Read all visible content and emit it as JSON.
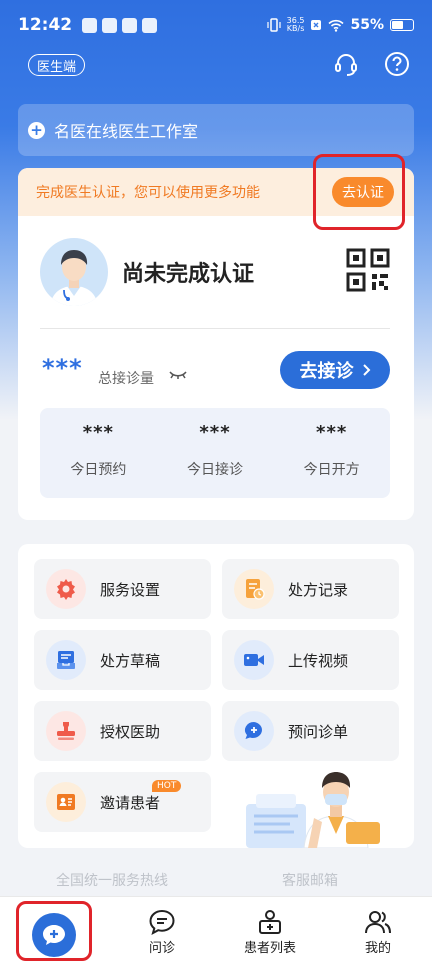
{
  "status_bar": {
    "time": "12:42",
    "net_speed_value": "36.5",
    "net_speed_unit": "KB/s",
    "battery": "55%",
    "battery_level": 0.55
  },
  "header": {
    "role_label": "医生端",
    "support_icon": "headset-icon",
    "help_icon": "question-icon"
  },
  "studio": {
    "label": "名医在线医生工作室"
  },
  "notice": {
    "text": "完成医生认证，您可以使用更多功能",
    "action": "去认证"
  },
  "profile": {
    "title": "尚未完成认证"
  },
  "totals": {
    "value": "***",
    "label": "总接诊量",
    "consult_button": "去接诊"
  },
  "stats": [
    {
      "value": "***",
      "label": "今日预约"
    },
    {
      "value": "***",
      "label": "今日接诊"
    },
    {
      "value": "***",
      "label": "今日开方"
    }
  ],
  "services": [
    {
      "label": "服务设置",
      "icon": "gear-icon",
      "color": "#ef5b4a",
      "bg": "#fde7e4"
    },
    {
      "label": "处方记录",
      "icon": "prescription-record-icon",
      "color": "#f6a23b",
      "bg": "#fdeedb"
    },
    {
      "label": "处方草稿",
      "icon": "draft-icon",
      "color": "#2f6fe0",
      "bg": "#e1ebfb"
    },
    {
      "label": "上传视频",
      "icon": "video-icon",
      "color": "#2f6fe0",
      "bg": "#e1ebfb"
    },
    {
      "label": "授权医助",
      "icon": "stamp-icon",
      "color": "#ef5b4a",
      "bg": "#fde7e4"
    },
    {
      "label": "预问诊单",
      "icon": "chat-plus-icon",
      "color": "#2f6fe0",
      "bg": "#e1ebfb"
    },
    {
      "label": "邀请患者",
      "icon": "invite-card-icon",
      "color": "#f07a23",
      "bg": "#fdeedb",
      "badge": "HOT"
    }
  ],
  "footer": {
    "hotline": "全国统一服务热线",
    "email": "客服邮箱"
  },
  "tabbar": {
    "consult": "问诊",
    "patients": "患者列表",
    "mine": "我的"
  },
  "colors": {
    "primary": "#2b6ed9",
    "accent": "#f98a2c",
    "highlight": "#e0242a"
  }
}
